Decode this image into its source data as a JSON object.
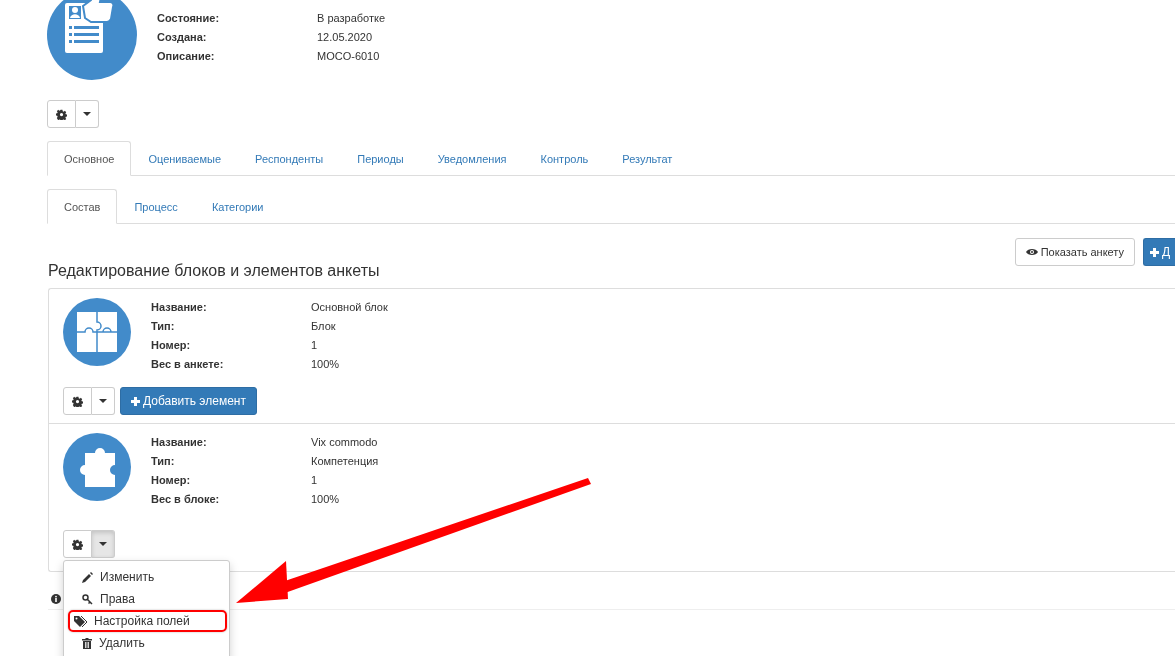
{
  "header": {
    "fields": [
      {
        "label": "Состояние:",
        "value": "В разработке"
      },
      {
        "label": "Создана:",
        "value": "12.05.2020"
      },
      {
        "label": "Описание:",
        "value": "MOCO-6010"
      }
    ]
  },
  "tabs": [
    {
      "label": "Основное",
      "selected": true
    },
    {
      "label": "Оцениваемые",
      "selected": false
    },
    {
      "label": "Респонденты",
      "selected": false
    },
    {
      "label": "Периоды",
      "selected": false
    },
    {
      "label": "Уведомления",
      "selected": false
    },
    {
      "label": "Контроль",
      "selected": false
    },
    {
      "label": "Результат",
      "selected": false
    }
  ],
  "subtabs": [
    {
      "label": "Состав",
      "selected": true
    },
    {
      "label": "Процесс",
      "selected": false
    },
    {
      "label": "Категории",
      "selected": false
    }
  ],
  "section": {
    "title": "Редактирование блоков и элементов анкеты",
    "show_button": "Показать анкету",
    "add_button": "Д"
  },
  "blocks": [
    {
      "kind": "block",
      "fields": [
        {
          "label": "Название:",
          "value": "Основной блок"
        },
        {
          "label": "Тип:",
          "value": "Блок"
        },
        {
          "label": "Номер:",
          "value": "1"
        },
        {
          "label": "Вес в анкете:",
          "value": "100%"
        }
      ],
      "add_button": "Добавить элемент",
      "menu_open": false
    },
    {
      "kind": "competence",
      "fields": [
        {
          "label": "Название:",
          "value": "Vix commodo"
        },
        {
          "label": "Тип:",
          "value": "Компетенция"
        },
        {
          "label": "Номер:",
          "value": "1"
        },
        {
          "label": "Вес в блоке:",
          "value": "100%"
        }
      ],
      "menu_open": true
    }
  ],
  "menu": [
    {
      "kind": "edit",
      "label": "Изменить",
      "highlighted": false
    },
    {
      "kind": "rights",
      "label": "Права",
      "highlighted": false
    },
    {
      "kind": "fields",
      "label": "Настройка полей",
      "highlighted": true
    },
    {
      "kind": "delete",
      "label": "Удалить",
      "highlighted": false
    }
  ]
}
